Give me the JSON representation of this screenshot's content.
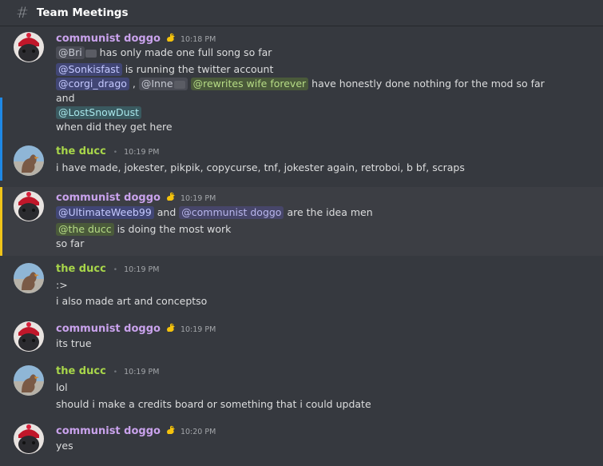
{
  "channel": {
    "hash": "#",
    "name": "Team Meetings"
  },
  "users": {
    "doggo": "communist doggo",
    "ducc": "the ducc"
  },
  "bullet": "•",
  "messages": [
    {
      "author": "communist doggo",
      "time": "10:18 PM",
      "lines": {
        "l1_mention": "@Bri",
        "l1_text": "has only made one full song so far",
        "l2_mention": "@Sonkisfast",
        "l2_text": "is running the twitter account",
        "l3_m1": "@corgi_drago",
        "l3_sep": ",",
        "l3_m2": "@Inne",
        "l3_m3": "@rewrites wife forever",
        "l3_text": "have honestly done nothing for the mod so far",
        "l4": "and",
        "l5_mention": "@LostSnowDust",
        "l6": "when did they get here"
      }
    },
    {
      "author": "the ducc",
      "time": "10:19 PM",
      "lines": {
        "l1": "i have made, jokester, pikpik, copycurse, tnf, jokester again, retroboi, b bf, scraps"
      }
    },
    {
      "author": "communist doggo",
      "time": "10:19 PM",
      "lines": {
        "l1_m1": "@UltimateWeeb99",
        "l1_and": "and",
        "l1_m2": "@communist doggo",
        "l1_text": "are the idea men",
        "l2_mention": "@the ducc",
        "l2_text": "is doing the most work",
        "l3": "so far"
      }
    },
    {
      "author": "the ducc",
      "time": "10:19 PM",
      "lines": {
        "l1": ":>",
        "l2": "i also made art and conceptso"
      }
    },
    {
      "author": "communist doggo",
      "time": "10:19 PM",
      "lines": {
        "l1": "its true"
      }
    },
    {
      "author": "the ducc",
      "time": "10:19 PM",
      "lines": {
        "l1": "lol",
        "l2": "should i make a credits board or something that i could update"
      }
    },
    {
      "author": "communist doggo",
      "time": "10:20 PM",
      "lines": {
        "l1": "yes"
      }
    }
  ],
  "colors": {
    "background": "#36393f",
    "doggo_name": "#c9a2ec",
    "ducc_name": "#a8d64a",
    "accent_blue": "#1e88e5",
    "accent_yellow": "#f0c419"
  },
  "icons": {
    "channel": "hash-icon",
    "badge": "duck-badge-icon",
    "avatar_doggo": "red-beanie-dog-avatar",
    "avatar_ducc": "duck-avatar"
  }
}
